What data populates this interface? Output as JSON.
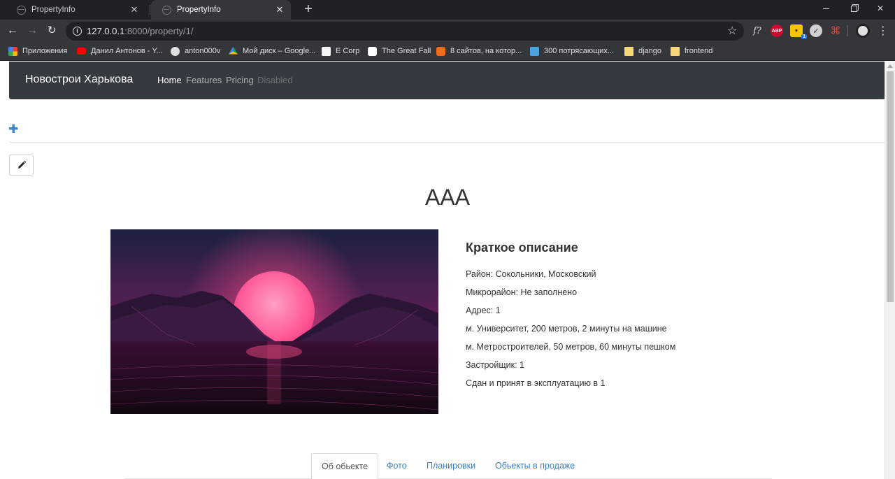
{
  "browser": {
    "tabs": [
      {
        "title": "PropertyInfo",
        "active": false
      },
      {
        "title": "PropertyInfo",
        "active": true
      }
    ],
    "tab_close_glyph": "✕",
    "new_tab_glyph": "+",
    "url_host": "127.0.0.1",
    "url_rest": ":8000/property/1/",
    "bookmarks": [
      {
        "label": "Приложения",
        "icon": "apps-icon"
      },
      {
        "label": "Данил Антонов - Y...",
        "icon": "youtube-icon"
      },
      {
        "label": "anton000v",
        "icon": "github-icon"
      },
      {
        "label": "Мой диск – Google...",
        "icon": "google-drive-icon"
      },
      {
        "label": "E Corp",
        "icon": "ecorp-icon"
      },
      {
        "label": "The Great Fall",
        "icon": "site-icon"
      },
      {
        "label": "8 сайтов, на котор...",
        "icon": "site-icon"
      },
      {
        "label": "300 потрясающих...",
        "icon": "site-icon"
      },
      {
        "label": "django",
        "icon": "folder-icon"
      },
      {
        "label": "frontend",
        "icon": "folder-icon"
      }
    ],
    "extension_labels": {
      "abp": "ABP",
      "fq": "f?"
    }
  },
  "site": {
    "brand": "Новострои Харькова",
    "nav": {
      "home": "Home",
      "features": "Features",
      "pricing": "Pricing",
      "disabled": "Disabled"
    }
  },
  "property": {
    "title": "AAA",
    "description_heading": "Краткое описание",
    "details": [
      "Район: Сокольники, Московский",
      "Микрорайон: Не заполнено",
      "Адрес: 1",
      "м. Университет, 200 метров, 2 минуты на машине",
      "м. Метростроителей, 50 метров, 60 минуты пешком",
      "Застройщик: 1",
      "Сдан и принят в эксплуатацию в 1"
    ],
    "tabs": [
      "Об обьекте",
      "Фото",
      "Планировки",
      "Обьекты в продаже"
    ],
    "active_tab": "Об обьекте"
  },
  "colors": {
    "navbar_bg": "#343a40",
    "link": "#3b7fc4",
    "browser_dark": "#202124",
    "browser_toolbar": "#35363a"
  }
}
